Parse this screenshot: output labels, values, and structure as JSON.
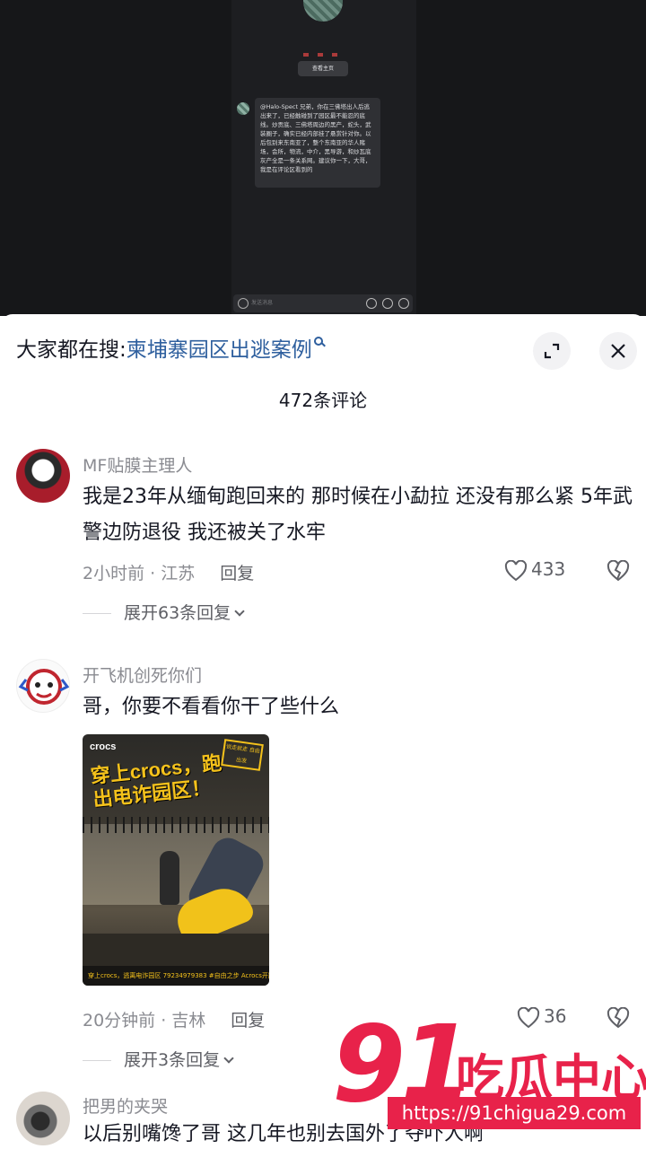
{
  "video": {
    "button_label": "查看主页",
    "message": "@Halo-Spect 兄弟，你在三佛塔出人后逃出来了，已经触碰到了园区最不能忍的底线。炒贡底、三佛塔周边的黑产，蛇头，武装圈子，确实已经内部挂了悬赏针对你。以后包别来东南亚了，整个东南亚的华人赌场，会所，物流，中介，黑导游，和炒瓦底灰产全是一条关系网。建议你一下，大哥，我是在评论区看到的",
    "input_placeholder": "发送消息"
  },
  "panel": {
    "search_prefix": "大家都在搜:",
    "search_term": "柬埔寨园区出逃案例",
    "comment_count": "472条评论"
  },
  "comments": [
    {
      "username": "MF贴膜主理人",
      "text": "我是23年从缅甸跑回来的 那时候在小勐拉 还没有那么紧 5年武警边防退役 我还被关了水牢",
      "meta": "2小时前 · 江苏",
      "reply_label": "回复",
      "likes": "433",
      "expand_label": "展开63条回复"
    },
    {
      "username": "开飞机创死你们",
      "text": "哥，你要不看看你干了些什么",
      "meta": "20分钟前 · 吉林",
      "reply_label": "回复",
      "likes": "36",
      "expand_label": "展开3条回复",
      "image": {
        "brand": "crocs",
        "headline": "穿上crocs，跑出电诈园区！",
        "tag": "说走就走 自由出发",
        "footer": "穿上crocs，逃离电诈园区  79234979383  #自由之步 Acrocs开跑"
      }
    },
    {
      "username": "把男的夹哭",
      "text": "以后别嘴馋了哥 这几年也别去国外了夺吓人啊"
    }
  ],
  "watermark": {
    "number": "91",
    "name": "吃瓜中心",
    "url": "https://91chigua29.com"
  },
  "colors": {
    "link": "#2e5f9e",
    "watermark": "#e8224a",
    "muted": "#8a8b91"
  }
}
